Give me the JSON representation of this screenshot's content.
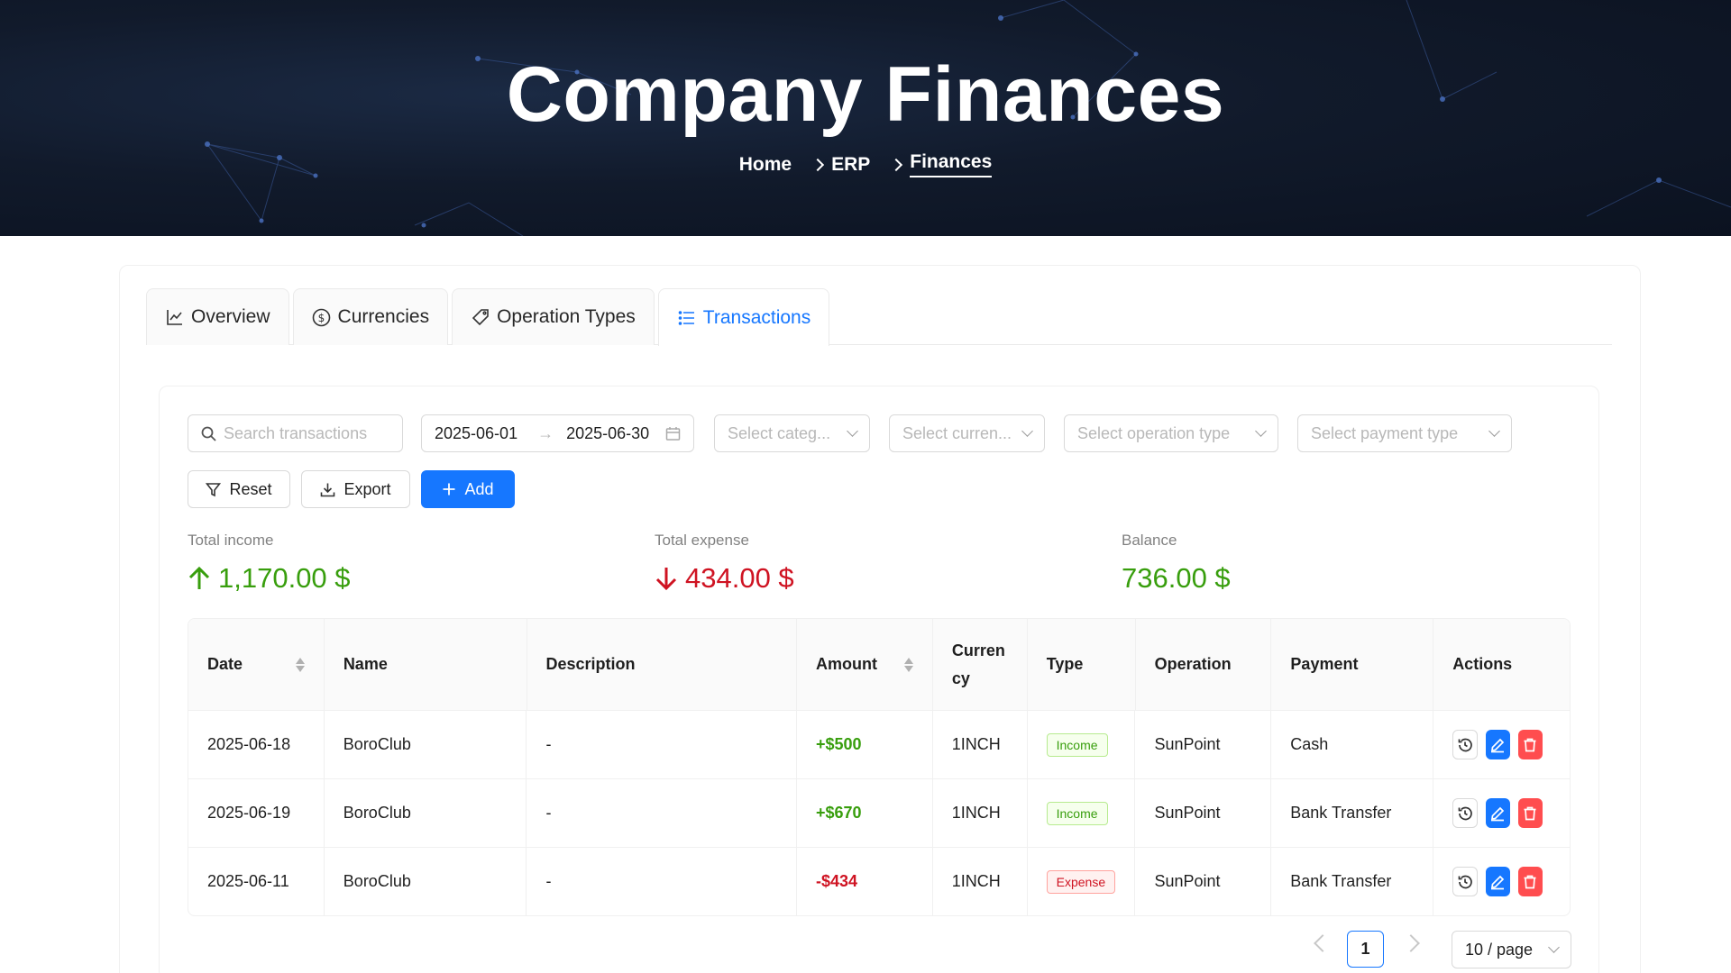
{
  "hero": {
    "title": "Company Finances",
    "breadcrumb": [
      "Home",
      "ERP",
      "Finances"
    ]
  },
  "tabs": [
    {
      "label": "Overview",
      "icon": "line-chart-icon"
    },
    {
      "label": "Currencies",
      "icon": "dollar-circle-icon"
    },
    {
      "label": "Operation Types",
      "icon": "tag-icon"
    },
    {
      "label": "Transactions",
      "icon": "list-icon",
      "active": true
    }
  ],
  "filters": {
    "search_placeholder": "Search transactions",
    "date_start": "2025-06-01",
    "date_end": "2025-06-30",
    "category_placeholder": "Select categ...",
    "currency_placeholder": "Select curren...",
    "operation_type_placeholder": "Select operation type",
    "payment_type_placeholder": "Select payment type"
  },
  "actions": {
    "reset_label": "Reset",
    "export_label": "Export",
    "add_label": "Add"
  },
  "stats": {
    "income_label": "Total income",
    "income_value": "1,170.00 $",
    "expense_label": "Total expense",
    "expense_value": "434.00 $",
    "balance_label": "Balance",
    "balance_value": "736.00 $"
  },
  "table": {
    "headers": {
      "date": "Date",
      "name": "Name",
      "description": "Description",
      "amount": "Amount",
      "currency": "Curren cy",
      "type": "Type",
      "operation": "Operation",
      "payment": "Payment",
      "actions": "Actions"
    },
    "rows": [
      {
        "date": "2025-06-18",
        "name": "BoroClub",
        "description": "-",
        "amount": "+$500",
        "currency": "1INCH",
        "type": "Income",
        "operation": "SunPoint",
        "payment": "Cash"
      },
      {
        "date": "2025-06-19",
        "name": "BoroClub",
        "description": "-",
        "amount": "+$670",
        "currency": "1INCH",
        "type": "Income",
        "operation": "SunPoint",
        "payment": "Bank Transfer"
      },
      {
        "date": "2025-06-11",
        "name": "BoroClub",
        "description": "-",
        "amount": "-$434",
        "currency": "1INCH",
        "type": "Expense",
        "operation": "SunPoint",
        "payment": "Bank Transfer"
      }
    ]
  },
  "pagination": {
    "current_page": "1",
    "page_size": "10 / page"
  },
  "colors": {
    "primary": "#1677ff",
    "income": "#389e0d",
    "expense": "#cf1322",
    "danger": "#ff4d4f"
  }
}
